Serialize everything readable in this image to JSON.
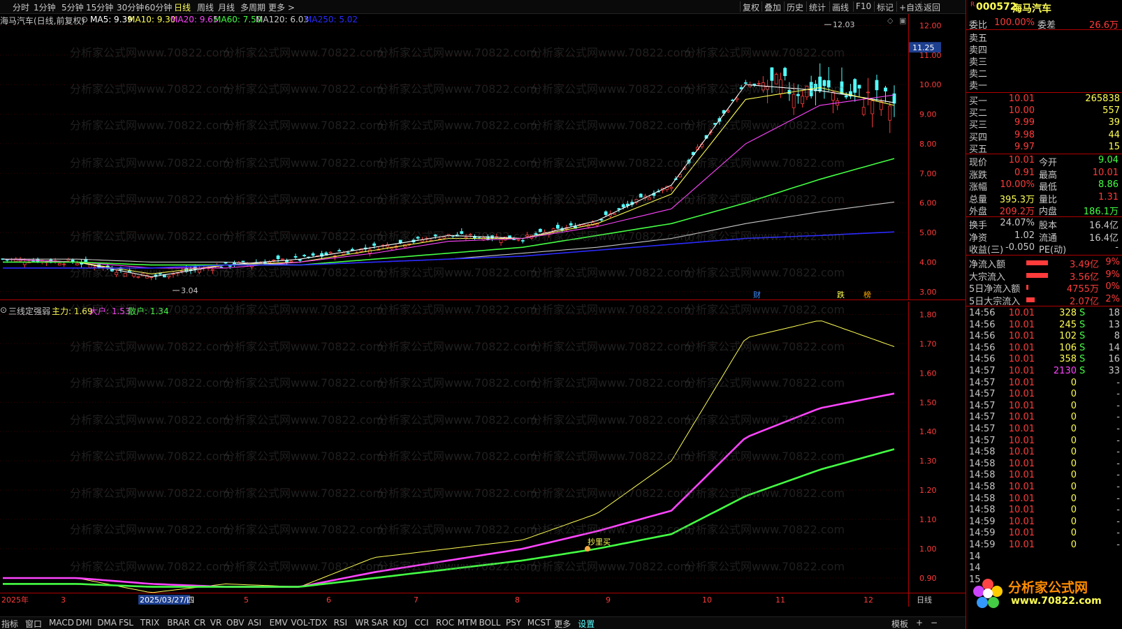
{
  "periods": [
    "分时",
    "1分钟",
    "5分钟",
    "15分钟",
    "30分钟",
    "60分钟",
    "日线",
    "周线",
    "月线",
    "多周期",
    "更多 >"
  ],
  "active_period": "日线",
  "tools": [
    "复权",
    "叠加",
    "历史",
    "统计",
    "画线",
    "F10",
    "标记",
    "+自选",
    "返回"
  ],
  "main_legend": {
    "title": "海马汽车(日线,前复权)",
    "ma5": "MA5: 9.39",
    "ma10": "MA10: 9.30",
    "ma20": "MA20: 9.65",
    "ma60": "MA60: 7.50",
    "ma120": "MA120: 6.03",
    "ma250": "MA250: 5.02"
  },
  "sub_legend": {
    "title": "三线定强弱",
    "zhuli": "主力: 1.69",
    "dahu": "大户: 1.53",
    "sanhu": "散户: 1.34"
  },
  "main_axis_labels": [
    "12.00",
    "11.00",
    "10.00",
    "9.00",
    "8.00",
    "7.00",
    "6.00",
    "5.00",
    "4.00",
    "3.00"
  ],
  "price_tag": "11.25",
  "sub_axis_labels": [
    "1.80",
    "1.70",
    "1.60",
    "1.50",
    "1.40",
    "1.30",
    "1.20",
    "1.10",
    "1.00",
    "0.90"
  ],
  "high_mark": "12.03",
  "low_mark": "3.04",
  "event_marks": [
    "财",
    "跌",
    "榜"
  ],
  "signal_label": "抄里买",
  "date_axis": {
    "year": "2025年",
    "selected_date": "2025/03/27/四",
    "months": [
      "3",
      "5",
      "6",
      "7",
      "8",
      "9",
      "10",
      "11",
      "12"
    ],
    "period_label": "日线"
  },
  "bottom_tabs": [
    "指标",
    "窗口",
    "MACD",
    "DMI",
    "DMA",
    "FSL",
    "TRIX",
    "BRAR",
    "CR",
    "VR",
    "OBV",
    "ASI",
    "EMV",
    "VOL-TDX",
    "RSI",
    "WR",
    "SAR",
    "KDJ",
    "CCI",
    "ROC",
    "MTM",
    "BOLL",
    "PSY",
    "MCST",
    "更多",
    "设置"
  ],
  "bottom_right": [
    "模板",
    "+",
    "−"
  ],
  "watermark": "分析家公式网www.70822.com",
  "stock": {
    "code": "000572",
    "name": "海马汽车",
    "flag": "R"
  },
  "weibi": {
    "label": "委比",
    "value": "100.00%",
    "label2": "委差",
    "value2": "26.6万"
  },
  "sell": [
    {
      "label": "卖五",
      "price": "",
      "vol": ""
    },
    {
      "label": "卖四",
      "price": "",
      "vol": ""
    },
    {
      "label": "卖三",
      "price": "",
      "vol": ""
    },
    {
      "label": "卖二",
      "price": "",
      "vol": ""
    },
    {
      "label": "卖一",
      "price": "",
      "vol": ""
    }
  ],
  "buy": [
    {
      "label": "买一",
      "price": "10.01",
      "vol": "265838"
    },
    {
      "label": "买二",
      "price": "10.00",
      "vol": "557"
    },
    {
      "label": "买三",
      "price": "9.99",
      "vol": "39"
    },
    {
      "label": "买四",
      "price": "9.98",
      "vol": "44"
    },
    {
      "label": "买五",
      "price": "9.97",
      "vol": "15"
    }
  ],
  "quote": [
    {
      "l1": "现价",
      "v1": "10.01",
      "l2": "今开",
      "v2": "9.04"
    },
    {
      "l1": "涨跌",
      "v1": "0.91",
      "l2": "最高",
      "v2": "10.01"
    },
    {
      "l1": "涨幅",
      "v1": "10.00%",
      "l2": "最低",
      "v2": "8.86"
    },
    {
      "l1": "总量",
      "v1": "395.3万",
      "l2": "量比",
      "v2": "1.31"
    },
    {
      "l1": "外盘",
      "v1": "209.2万",
      "l2": "内盘",
      "v2": "186.1万"
    }
  ],
  "fundamentals": [
    {
      "l1": "换手",
      "v1": "24.07%",
      "l2": "股本",
      "v2": "16.4亿"
    },
    {
      "l1": "净资",
      "v1": "1.02",
      "l2": "流通",
      "v2": "16.4亿"
    },
    {
      "l1": "收益(三)",
      "v1": "-0.050",
      "l2": "PE(动)",
      "v2": "-"
    }
  ],
  "flows": [
    {
      "label": "净流入额",
      "value": "3.49亿",
      "pct": "9%",
      "bar": 0.9
    },
    {
      "label": "大宗流入",
      "value": "3.56亿",
      "pct": "9%",
      "bar": 0.9
    },
    {
      "label": "5日净流入额",
      "value": "4755万",
      "pct": "0%",
      "bar": 0.1
    },
    {
      "label": "5日大宗流入",
      "value": "2.07亿",
      "pct": "2%",
      "bar": 0.35
    }
  ],
  "ticks": [
    {
      "time": "14:56",
      "price": "10.01",
      "vol": "328",
      "side": "S",
      "n": "18"
    },
    {
      "time": "14:56",
      "price": "10.01",
      "vol": "245",
      "side": "S",
      "n": "13"
    },
    {
      "time": "14:56",
      "price": "10.01",
      "vol": "102",
      "side": "S",
      "n": "8"
    },
    {
      "time": "14:56",
      "price": "10.01",
      "vol": "106",
      "side": "S",
      "n": "14"
    },
    {
      "time": "14:56",
      "price": "10.01",
      "vol": "358",
      "side": "S",
      "n": "16"
    },
    {
      "time": "14:57",
      "price": "10.01",
      "vol": "2130",
      "side": "S",
      "n": "33"
    },
    {
      "time": "14:57",
      "price": "10.01",
      "vol": "0",
      "side": "",
      "n": "-"
    },
    {
      "time": "14:57",
      "price": "10.01",
      "vol": "0",
      "side": "",
      "n": "-"
    },
    {
      "time": "14:57",
      "price": "10.01",
      "vol": "0",
      "side": "",
      "n": "-"
    },
    {
      "time": "14:57",
      "price": "10.01",
      "vol": "0",
      "side": "",
      "n": "-"
    },
    {
      "time": "14:57",
      "price": "10.01",
      "vol": "0",
      "side": "",
      "n": "-"
    },
    {
      "time": "14:57",
      "price": "10.01",
      "vol": "0",
      "side": "",
      "n": "-"
    },
    {
      "time": "14:58",
      "price": "10.01",
      "vol": "0",
      "side": "",
      "n": "-"
    },
    {
      "time": "14:58",
      "price": "10.01",
      "vol": "0",
      "side": "",
      "n": "-"
    },
    {
      "time": "14:58",
      "price": "10.01",
      "vol": "0",
      "side": "",
      "n": "-"
    },
    {
      "time": "14:58",
      "price": "10.01",
      "vol": "0",
      "side": "",
      "n": "-"
    },
    {
      "time": "14:58",
      "price": "10.01",
      "vol": "0",
      "side": "",
      "n": "-"
    },
    {
      "time": "14:58",
      "price": "10.01",
      "vol": "0",
      "side": "",
      "n": "-"
    },
    {
      "time": "14:59",
      "price": "10.01",
      "vol": "0",
      "side": "",
      "n": "-"
    },
    {
      "time": "14:59",
      "price": "10.01",
      "vol": "0",
      "side": "",
      "n": "-"
    },
    {
      "time": "14:59",
      "price": "10.01",
      "vol": "0",
      "side": "",
      "n": "-"
    },
    {
      "time": "14",
      "price": "",
      "vol": "",
      "side": "",
      "n": ""
    },
    {
      "time": "14",
      "price": "",
      "vol": "",
      "side": "",
      "n": ""
    },
    {
      "time": "15",
      "price": "",
      "vol": "",
      "side": "",
      "n": ""
    }
  ],
  "logo": {
    "text": "分析家公式网",
    "url": "www.70822.com"
  },
  "colors": {
    "up": "#ff3b3b",
    "down": "#54ffff",
    "ma5": "#ffffff",
    "ma10": "#ffff55",
    "ma20": "#ff44ff",
    "ma60": "#44ff44",
    "ma120": "#c8c8c8",
    "ma250": "#2a2aff"
  },
  "chart_data": [
    {
      "type": "line",
      "title": "海马汽车(日线,前复权)",
      "ylim": [
        2.9,
        12.2
      ],
      "note": "approximate daily closes, 2025-02 to 2025-12",
      "x": [
        "2025-02",
        "2025-03",
        "2025-04",
        "2025-05",
        "2025-06",
        "2025-07",
        "2025-08",
        "2025-09",
        "2025-10",
        "2025-10-mid",
        "2025-11",
        "2025-11-mid",
        "2025-12"
      ],
      "series": [
        {
          "name": "MA5",
          "values": [
            4.1,
            4.0,
            3.5,
            3.9,
            4.1,
            4.5,
            4.9,
            4.8,
            5.4,
            6.6,
            10.0,
            9.8,
            9.39
          ]
        },
        {
          "name": "MA10",
          "values": [
            4.1,
            4.0,
            3.6,
            3.9,
            4.0,
            4.4,
            4.8,
            4.8,
            5.3,
            6.3,
            9.5,
            9.9,
            9.3
          ]
        },
        {
          "name": "MA20",
          "values": [
            4.1,
            4.0,
            3.8,
            3.8,
            4.0,
            4.3,
            4.7,
            4.8,
            5.2,
            5.8,
            8.0,
            9.3,
            9.65
          ]
        },
        {
          "name": "MA60",
          "values": [
            4.0,
            4.0,
            3.9,
            3.9,
            3.9,
            4.1,
            4.3,
            4.5,
            4.9,
            5.3,
            6.0,
            6.8,
            7.5
          ]
        },
        {
          "name": "MA120",
          "values": [
            4.1,
            4.1,
            4.0,
            4.0,
            3.9,
            4.0,
            4.1,
            4.3,
            4.5,
            4.8,
            5.3,
            5.7,
            6.03
          ]
        },
        {
          "name": "MA250",
          "values": [
            3.8,
            3.8,
            3.8,
            3.9,
            3.9,
            4.0,
            4.1,
            4.2,
            4.4,
            4.6,
            4.8,
            4.9,
            5.02
          ]
        }
      ]
    },
    {
      "type": "line",
      "title": "三线定强弱",
      "ylim": [
        0.85,
        1.82
      ],
      "x": [
        "2025-02",
        "2025-03",
        "2025-04",
        "2025-05",
        "2025-06",
        "2025-07",
        "2025-08",
        "2025-09",
        "2025-10",
        "2025-10-mid",
        "2025-11",
        "2025-11-mid",
        "2025-12"
      ],
      "series": [
        {
          "name": "主力",
          "values": [
            0.9,
            0.9,
            0.85,
            0.88,
            0.87,
            0.97,
            1.0,
            1.03,
            1.12,
            1.3,
            1.72,
            1.78,
            1.69
          ]
        },
        {
          "name": "大户",
          "values": [
            0.9,
            0.9,
            0.88,
            0.87,
            0.87,
            0.92,
            0.96,
            1.0,
            1.06,
            1.13,
            1.38,
            1.48,
            1.53
          ]
        },
        {
          "name": "散户",
          "values": [
            0.88,
            0.88,
            0.87,
            0.87,
            0.87,
            0.9,
            0.93,
            0.96,
            1.0,
            1.05,
            1.18,
            1.27,
            1.34
          ]
        }
      ]
    }
  ]
}
